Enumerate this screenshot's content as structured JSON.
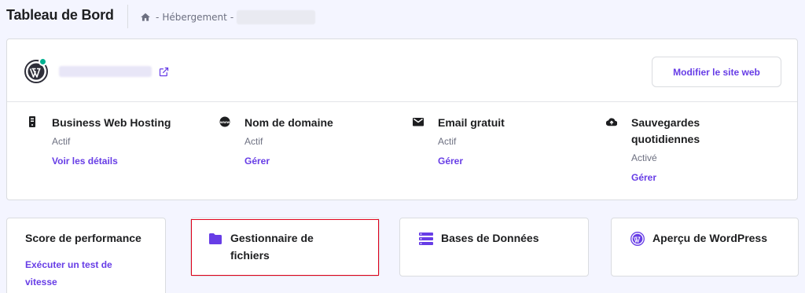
{
  "header": {
    "title": "Tableau de Bord",
    "breadcrumb_sep1": "-",
    "breadcrumb_item": "Hébergement",
    "breadcrumb_sep2": "-"
  },
  "site": {
    "edit_button": "Modifier le site web"
  },
  "services": [
    {
      "title": "Business Web Hosting",
      "status": "Actif",
      "link": "Voir les détails",
      "icon": "server-icon"
    },
    {
      "title": "Nom de domaine",
      "status": "Actif",
      "link": "Gérer",
      "icon": "www-icon"
    },
    {
      "title": "Email gratuit",
      "status": "Actif",
      "link": "Gérer",
      "icon": "envelope-icon"
    },
    {
      "title_line1": "Sauvegardes",
      "title_line2": "quotidiennes",
      "status": "Activé",
      "link": "Gérer",
      "icon": "cloud-upload-icon"
    }
  ],
  "tiles": [
    {
      "title": "Score de performance",
      "link_line1": "Exécuter un test de",
      "link_line2": "vitesse"
    },
    {
      "title_line1": "Gestionnaire de",
      "title_line2": "fichiers",
      "icon": "folder-icon"
    },
    {
      "title": "Bases de Données",
      "icon": "database-icon"
    },
    {
      "title": "Aperçu de WordPress",
      "icon": "wordpress-icon"
    }
  ],
  "colors": {
    "accent": "#673de6",
    "highlight": "#e0001b",
    "status_dot": "#00b090"
  }
}
